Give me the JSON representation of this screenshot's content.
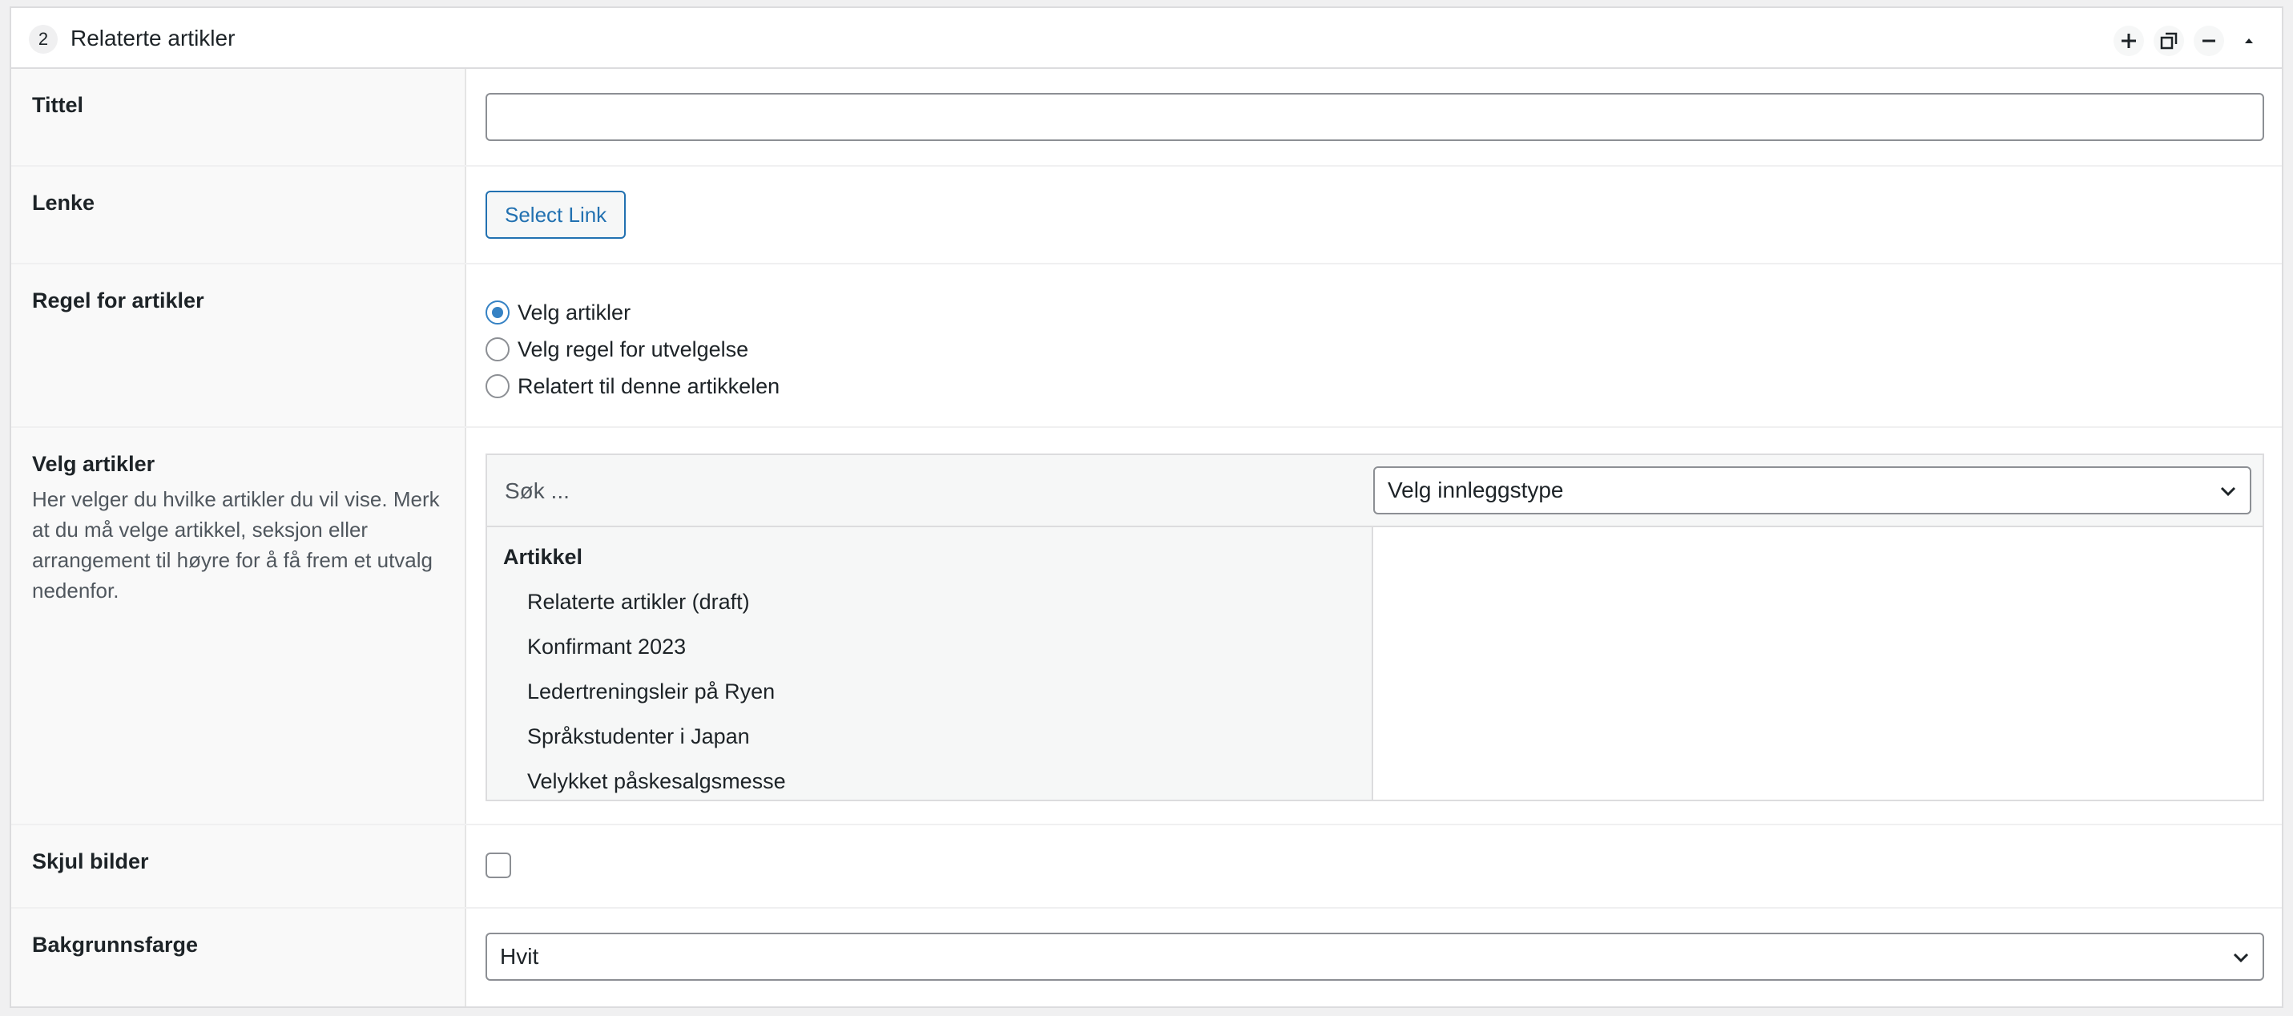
{
  "header": {
    "index": "2",
    "title": "Relaterte artikler"
  },
  "fields": {
    "tittel": {
      "label": "Tittel",
      "value": ""
    },
    "lenke": {
      "label": "Lenke",
      "button_label": "Select Link"
    },
    "regel": {
      "label": "Regel for artikler",
      "options": [
        "Velg artikler",
        "Velg regel for utvelgelse",
        "Relatert til denne artikkelen"
      ],
      "selected": "Velg artikler"
    },
    "velg_artikler": {
      "label": "Velg artikler",
      "description": "Her velger du hvilke artikler du vil vise. Merk at du må velge artikkel, seksjon eller arrangement til høyre for å få frem et utvalg nedenfor.",
      "search_placeholder": "Søk ...",
      "type_select": "Velg innleggstype",
      "group": "Artikkel",
      "items": [
        "Relaterte artikler (draft)",
        "Konfirmant 2023",
        "Ledertreningsleir på Ryen",
        "Språkstudenter i Japan",
        "Velykket påskesalgsmesse"
      ]
    },
    "skjul_bilder": {
      "label": "Skjul bilder",
      "checked": false
    },
    "bakgrunnsfarge": {
      "label": "Bakgrunnsfarge",
      "value": "Hvit"
    }
  },
  "colors": {
    "accent": "#2271b1",
    "radio_accent": "#3582c4",
    "border": "#dcdcde",
    "label_bg": "#f9f9f9"
  }
}
